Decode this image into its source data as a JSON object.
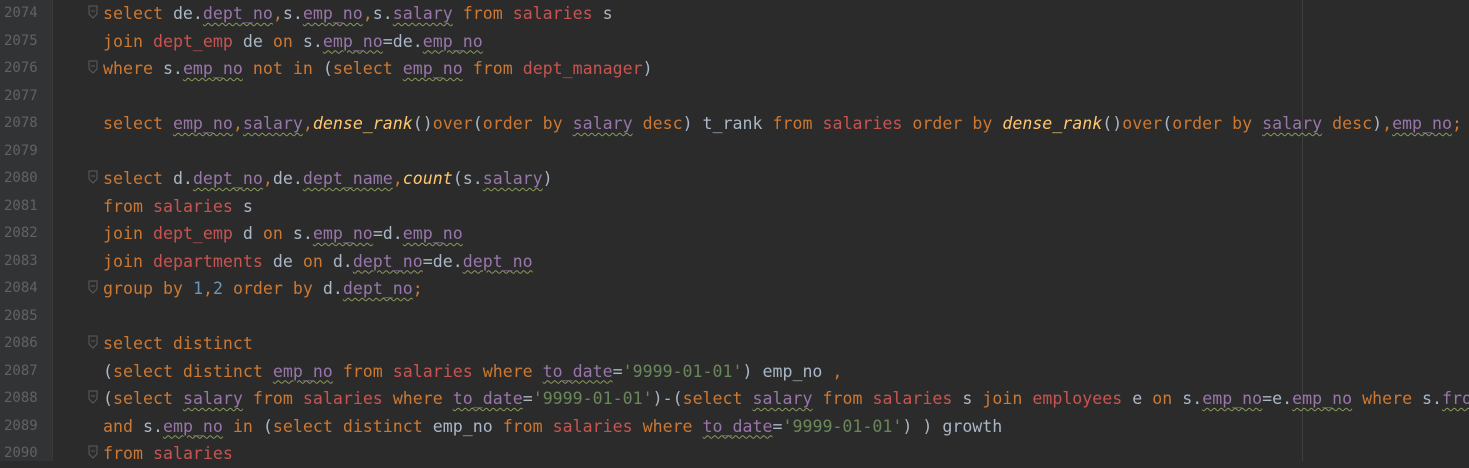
{
  "editor": {
    "colors": {
      "background": "#2b2b2b",
      "gutter": "#313335",
      "line_number": "#606366",
      "keyword": "#cc7832",
      "table": "#c75450",
      "column": "#9876aa",
      "string": "#6a8759",
      "function": "#ffc66d",
      "number": "#6897bb",
      "text": "#a9b7c6"
    },
    "lines": [
      {
        "num": "2074",
        "fold": true,
        "tokens": [
          [
            "kw",
            "select"
          ],
          [
            "plain",
            " de."
          ],
          [
            "col",
            "dept_no"
          ],
          [
            "kw",
            ","
          ],
          [
            "plain",
            "s."
          ],
          [
            "col",
            "emp_no"
          ],
          [
            "kw",
            ","
          ],
          [
            "plain",
            "s."
          ],
          [
            "col",
            "salary"
          ],
          [
            "plain",
            " "
          ],
          [
            "kw",
            "from"
          ],
          [
            "plain",
            " "
          ],
          [
            "tbl",
            "salaries"
          ],
          [
            "plain",
            " s"
          ]
        ]
      },
      {
        "num": "2075",
        "fold": false,
        "tokens": [
          [
            "kw",
            "join"
          ],
          [
            "plain",
            " "
          ],
          [
            "tbl",
            "dept_emp"
          ],
          [
            "plain",
            " de "
          ],
          [
            "kw",
            "on"
          ],
          [
            "plain",
            " s."
          ],
          [
            "col",
            "emp_no"
          ],
          [
            "plain",
            "=de."
          ],
          [
            "col",
            "emp_no"
          ]
        ]
      },
      {
        "num": "2076",
        "fold": true,
        "tokens": [
          [
            "kw",
            "where"
          ],
          [
            "plain",
            " s."
          ],
          [
            "col",
            "emp_no"
          ],
          [
            "plain",
            " "
          ],
          [
            "kw",
            "not in"
          ],
          [
            "plain",
            " ("
          ],
          [
            "kw",
            "select"
          ],
          [
            "plain",
            " "
          ],
          [
            "col",
            "emp_no"
          ],
          [
            "plain",
            " "
          ],
          [
            "kw",
            "from"
          ],
          [
            "plain",
            " "
          ],
          [
            "tbl",
            "dept_manager"
          ],
          [
            "plain",
            ")"
          ]
        ]
      },
      {
        "num": "2077",
        "fold": false,
        "tokens": []
      },
      {
        "num": "2078",
        "fold": false,
        "tokens": [
          [
            "kw",
            "select"
          ],
          [
            "plain",
            " "
          ],
          [
            "col",
            "emp_no"
          ],
          [
            "kw",
            ","
          ],
          [
            "col",
            "salary"
          ],
          [
            "kw",
            ","
          ],
          [
            "fn",
            "dense_rank"
          ],
          [
            "plain",
            "()"
          ],
          [
            "kw",
            "over"
          ],
          [
            "plain",
            "("
          ],
          [
            "kw",
            "order by"
          ],
          [
            "plain",
            " "
          ],
          [
            "col",
            "salary"
          ],
          [
            "plain",
            " "
          ],
          [
            "kw",
            "desc"
          ],
          [
            "plain",
            ") t_rank "
          ],
          [
            "kw",
            "from"
          ],
          [
            "plain",
            " "
          ],
          [
            "tbl",
            "salaries"
          ],
          [
            "plain",
            " "
          ],
          [
            "kw",
            "order by"
          ],
          [
            "plain",
            " "
          ],
          [
            "fn",
            "dense_rank"
          ],
          [
            "plain",
            "()"
          ],
          [
            "kw",
            "over"
          ],
          [
            "plain",
            "("
          ],
          [
            "kw",
            "order by"
          ],
          [
            "plain",
            " "
          ],
          [
            "col",
            "salary"
          ],
          [
            "plain",
            " "
          ],
          [
            "kw",
            "desc"
          ],
          [
            "plain",
            ")"
          ],
          [
            "kw",
            ","
          ],
          [
            "col",
            "emp_no"
          ],
          [
            "kw",
            ";"
          ]
        ]
      },
      {
        "num": "2079",
        "fold": false,
        "tokens": []
      },
      {
        "num": "2080",
        "fold": true,
        "tokens": [
          [
            "kw",
            "select"
          ],
          [
            "plain",
            " d."
          ],
          [
            "col",
            "dept_no"
          ],
          [
            "kw",
            ","
          ],
          [
            "plain",
            "de."
          ],
          [
            "col",
            "dept_name"
          ],
          [
            "kw",
            ","
          ],
          [
            "fn",
            "count"
          ],
          [
            "plain",
            "(s."
          ],
          [
            "col",
            "salary"
          ],
          [
            "plain",
            ")"
          ]
        ]
      },
      {
        "num": "2081",
        "fold": false,
        "tokens": [
          [
            "kw",
            "from"
          ],
          [
            "plain",
            " "
          ],
          [
            "tbl",
            "salaries"
          ],
          [
            "plain",
            " s"
          ]
        ]
      },
      {
        "num": "2082",
        "fold": false,
        "tokens": [
          [
            "kw",
            "join"
          ],
          [
            "plain",
            " "
          ],
          [
            "tbl",
            "dept_emp"
          ],
          [
            "plain",
            " d "
          ],
          [
            "kw",
            "on"
          ],
          [
            "plain",
            " s."
          ],
          [
            "col",
            "emp_no"
          ],
          [
            "plain",
            "=d."
          ],
          [
            "col",
            "emp_no"
          ]
        ]
      },
      {
        "num": "2083",
        "fold": false,
        "tokens": [
          [
            "kw",
            "join"
          ],
          [
            "plain",
            " "
          ],
          [
            "tbl",
            "departments"
          ],
          [
            "plain",
            " de "
          ],
          [
            "kw",
            "on"
          ],
          [
            "plain",
            " d."
          ],
          [
            "col",
            "dept_no"
          ],
          [
            "plain",
            "=de."
          ],
          [
            "col",
            "dept_no"
          ]
        ]
      },
      {
        "num": "2084",
        "fold": true,
        "tokens": [
          [
            "kw",
            "group by"
          ],
          [
            "plain",
            " "
          ],
          [
            "num",
            "1"
          ],
          [
            "kw",
            ","
          ],
          [
            "num",
            "2"
          ],
          [
            "plain",
            " "
          ],
          [
            "kw",
            "order by"
          ],
          [
            "plain",
            " d."
          ],
          [
            "col",
            "dept_no"
          ],
          [
            "kw",
            ";"
          ]
        ]
      },
      {
        "num": "2085",
        "fold": false,
        "tokens": []
      },
      {
        "num": "2086",
        "fold": true,
        "tokens": [
          [
            "kw",
            "select distinct"
          ]
        ]
      },
      {
        "num": "2087",
        "fold": false,
        "tokens": [
          [
            "plain",
            "("
          ],
          [
            "kw",
            "select distinct"
          ],
          [
            "plain",
            " "
          ],
          [
            "col",
            "emp_no"
          ],
          [
            "plain",
            " "
          ],
          [
            "kw",
            "from"
          ],
          [
            "plain",
            " "
          ],
          [
            "tbl",
            "salaries"
          ],
          [
            "plain",
            " "
          ],
          [
            "kw",
            "where"
          ],
          [
            "plain",
            " "
          ],
          [
            "col",
            "to_date"
          ],
          [
            "plain",
            "="
          ],
          [
            "str",
            "'9999-01-01'"
          ],
          [
            "plain",
            ") emp_no "
          ],
          [
            "kw",
            ","
          ]
        ]
      },
      {
        "num": "2088",
        "fold": true,
        "tokens": [
          [
            "plain",
            "("
          ],
          [
            "kw",
            "select"
          ],
          [
            "plain",
            " "
          ],
          [
            "col",
            "salary"
          ],
          [
            "plain",
            " "
          ],
          [
            "kw",
            "from"
          ],
          [
            "plain",
            " "
          ],
          [
            "tbl",
            "salaries"
          ],
          [
            "plain",
            " "
          ],
          [
            "kw",
            "where"
          ],
          [
            "plain",
            " "
          ],
          [
            "col",
            "to_date"
          ],
          [
            "plain",
            "="
          ],
          [
            "str",
            "'9999-01-01'"
          ],
          [
            "plain",
            ")-("
          ],
          [
            "kw",
            "select"
          ],
          [
            "plain",
            " "
          ],
          [
            "col",
            "salary"
          ],
          [
            "plain",
            " "
          ],
          [
            "kw",
            "from"
          ],
          [
            "plain",
            " "
          ],
          [
            "tbl",
            "salaries"
          ],
          [
            "plain",
            " s "
          ],
          [
            "kw",
            "join"
          ],
          [
            "plain",
            " "
          ],
          [
            "tbl",
            "employees"
          ],
          [
            "plain",
            " e "
          ],
          [
            "kw",
            "on"
          ],
          [
            "plain",
            " s."
          ],
          [
            "col",
            "emp_no"
          ],
          [
            "plain",
            "=e."
          ],
          [
            "col",
            "emp_no"
          ],
          [
            "plain",
            " "
          ],
          [
            "kw",
            "where"
          ],
          [
            "plain",
            " s."
          ],
          [
            "col",
            "fro"
          ]
        ]
      },
      {
        "num": "2089",
        "fold": false,
        "tokens": [
          [
            "kw",
            "and"
          ],
          [
            "plain",
            " s."
          ],
          [
            "col",
            "emp_no"
          ],
          [
            "plain",
            " "
          ],
          [
            "kw",
            "in"
          ],
          [
            "plain",
            " ("
          ],
          [
            "kw",
            "select distinct"
          ],
          [
            "plain",
            " emp_no "
          ],
          [
            "kw",
            "from"
          ],
          [
            "plain",
            " "
          ],
          [
            "tbl",
            "salaries"
          ],
          [
            "plain",
            " "
          ],
          [
            "kw",
            "where"
          ],
          [
            "plain",
            " "
          ],
          [
            "col",
            "to_date"
          ],
          [
            "plain",
            "="
          ],
          [
            "str",
            "'9999-01-01'"
          ],
          [
            "plain",
            ") ) growth"
          ]
        ]
      },
      {
        "num": "2090",
        "fold": true,
        "tokens": [
          [
            "kw",
            "from"
          ],
          [
            "plain",
            " "
          ],
          [
            "tbl",
            "salaries"
          ]
        ]
      }
    ]
  }
}
